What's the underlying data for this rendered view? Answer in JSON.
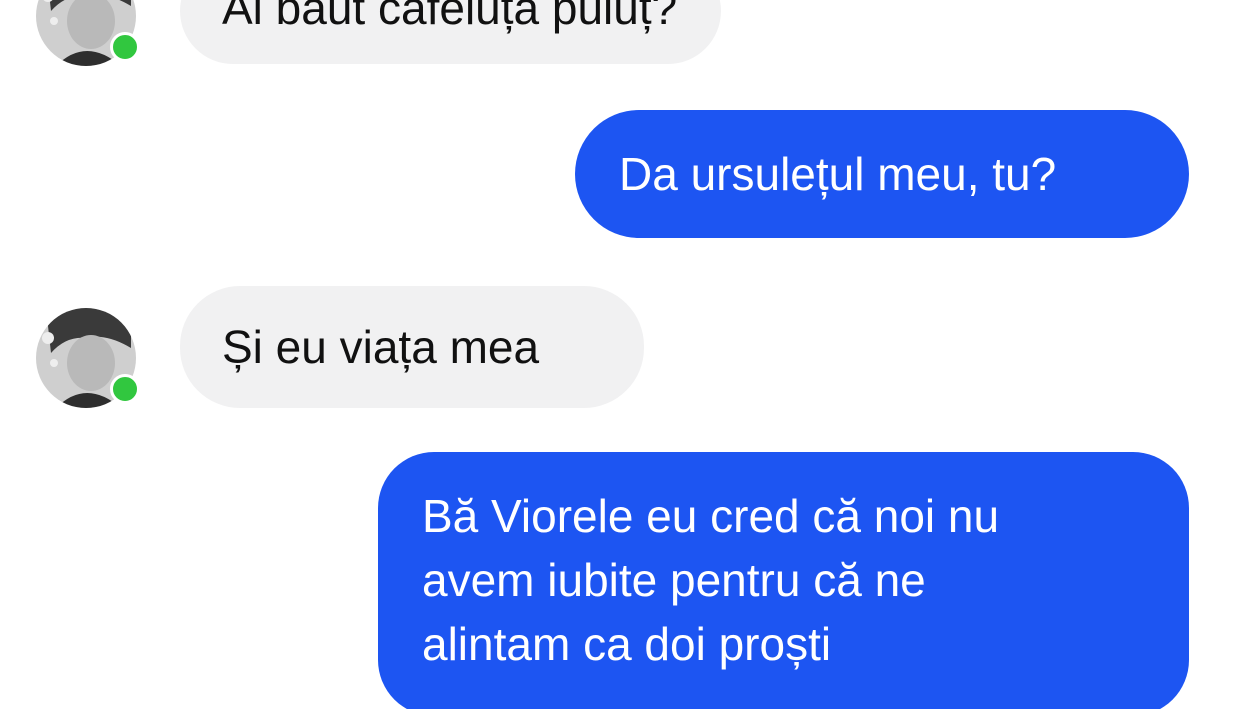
{
  "conversation": {
    "messages": [
      {
        "direction": "incoming",
        "text": "Ai băut cafeluța puiuț?",
        "sender_online": true
      },
      {
        "direction": "outgoing",
        "text": "Da ursulețul meu, tu?"
      },
      {
        "direction": "incoming",
        "text": "Și eu viața mea",
        "sender_online": true
      },
      {
        "direction": "outgoing",
        "lines": [
          "Bă Viorele eu cred că noi nu",
          "avem iubite pentru că ne",
          "alintam ca doi proști"
        ]
      }
    ]
  },
  "colors": {
    "outgoing_bubble": "#1d55f2",
    "incoming_bubble": "#f1f1f2",
    "online_indicator": "#31c73f",
    "background": "#ffffff"
  },
  "icons": {
    "avatar": "contact-avatar-photo",
    "status": "online-status-dot"
  }
}
